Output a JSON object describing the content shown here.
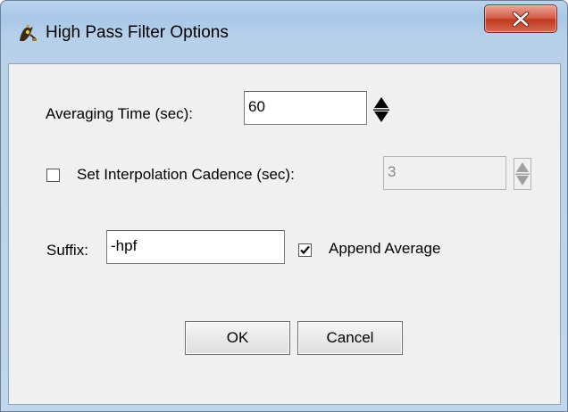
{
  "window": {
    "title": "High Pass Filter Options"
  },
  "averaging": {
    "label": "Averaging Time (sec):",
    "value": "60"
  },
  "interpolation": {
    "label": "Set Interpolation Cadence (sec):",
    "checked": false,
    "value": "3",
    "enabled": false
  },
  "suffix": {
    "label": "Suffix:",
    "value": "-hpf"
  },
  "append_average": {
    "label": "Append Average",
    "checked": true
  },
  "buttons": {
    "ok_label": "OK",
    "cancel_label": "Cancel"
  },
  "icons": {
    "app": "app-icon",
    "close": "close-icon",
    "spin_up": "spin-up-icon",
    "spin_down": "spin-down-icon",
    "check": "checkmark-icon"
  },
  "colors": {
    "title_bar": "#b9d2ed",
    "close_button": "#c8452a",
    "dialog_bg": "#f0f0f0",
    "disabled_text": "#8a8a8a"
  }
}
